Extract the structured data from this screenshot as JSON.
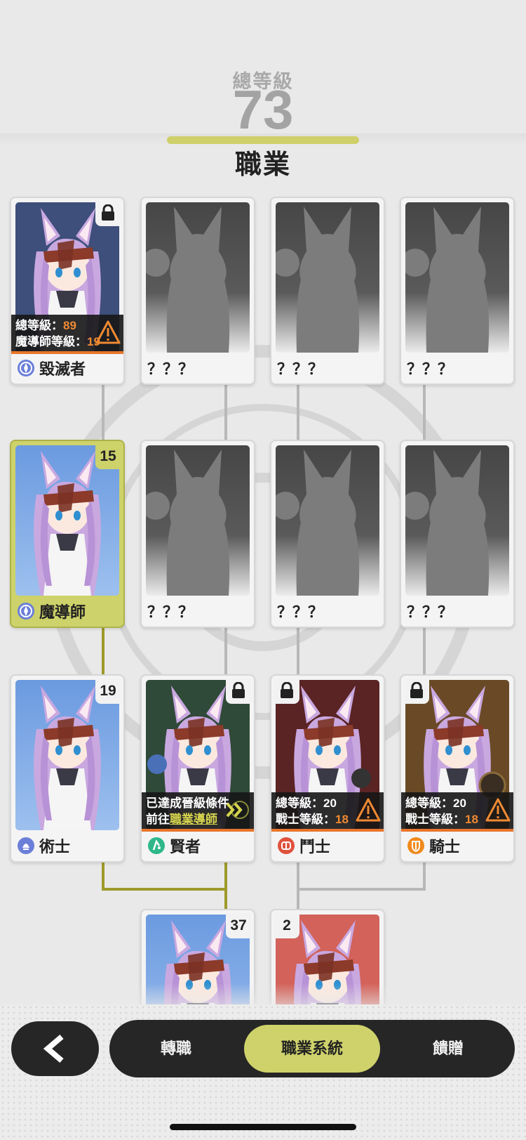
{
  "header": {
    "total_level_label": "總等級",
    "total_level_value": "73",
    "title": "職業"
  },
  "cards": {
    "destroyer": {
      "name": "毀滅者",
      "req_line1_label": "總等級：",
      "req_line1_value": "89",
      "req_line2_label": "魔導師等級：",
      "req_line2_value": "19",
      "locked": true
    },
    "unknown_1": {
      "name": "？？？"
    },
    "unknown_2": {
      "name": "？？？"
    },
    "unknown_3": {
      "name": "？？？"
    },
    "mage": {
      "name": "魔導師",
      "level": "15",
      "selected": true
    },
    "unknown_4": {
      "name": "？？？"
    },
    "unknown_5": {
      "name": "？？？"
    },
    "unknown_6": {
      "name": "？？？"
    },
    "sorcerer": {
      "name": "術士",
      "level": "19"
    },
    "sage": {
      "name": "賢者",
      "status_line1": "已達成晉級條件",
      "status_line2_prefix": "前往",
      "status_line2_link": "職業導師",
      "locked": true
    },
    "fighter": {
      "name": "鬥士",
      "req_line1_label": "總等級：",
      "req_line1_value": "20",
      "req_line2_label": "戰士等級：",
      "req_line2_value": "18",
      "locked": true
    },
    "knight": {
      "name": "騎士",
      "req_line1_label": "總等級：",
      "req_line1_value": "20",
      "req_line2_label": "戰士等級：",
      "req_line2_value": "18",
      "locked": true
    },
    "bottom_left": {
      "level": "37"
    },
    "bottom_right": {
      "level": "2"
    }
  },
  "nav": {
    "back_icon": "chevron-left-icon",
    "tabs": [
      "轉職",
      "職業系統",
      "饋贈"
    ],
    "active_tab": "職業系統"
  },
  "colors": {
    "accent": "#cfd26b",
    "warning": "#f08a33",
    "dark": "#262626",
    "background": "#e9e9e9"
  }
}
